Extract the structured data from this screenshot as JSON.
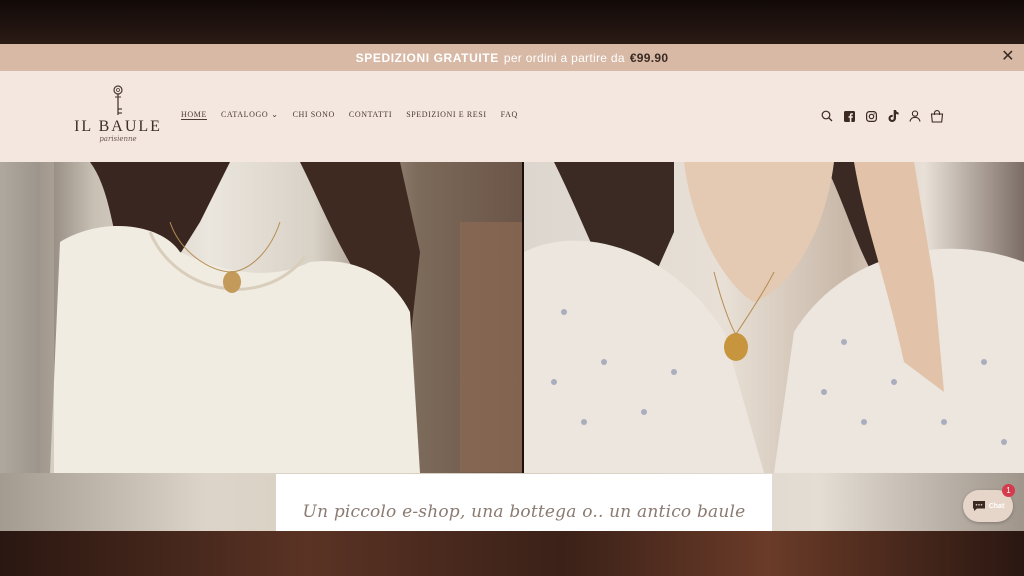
{
  "announcement": {
    "strong": "SPEDIZIONI GRATUITE",
    "text": "per ordini a partire da",
    "price": "€99.90",
    "close_symbol": "✕"
  },
  "logo": {
    "name": "IL BAULE",
    "sub": "parisienne",
    "icon": "key-icon"
  },
  "nav": {
    "items": [
      {
        "label": "HOME",
        "active": true
      },
      {
        "label": "CATALOGO",
        "has_dropdown": true
      },
      {
        "label": "CHI SONO"
      },
      {
        "label": "CONTATTI"
      },
      {
        "label": "SPEDIZIONI E RESI"
      },
      {
        "label": "FAQ"
      }
    ]
  },
  "header_icons": [
    "search-icon",
    "facebook-icon",
    "instagram-icon",
    "tiktok-icon",
    "account-icon",
    "cart-icon"
  ],
  "hero": {
    "caption": "Un piccolo e-shop, una bottega o.. un antico baule"
  },
  "chat": {
    "label": "Chat",
    "badge": "1"
  },
  "colors": {
    "announce_bg": "#d8b9a6",
    "header_bg": "#f3e7df",
    "chat_badge": "#d53a4d"
  }
}
